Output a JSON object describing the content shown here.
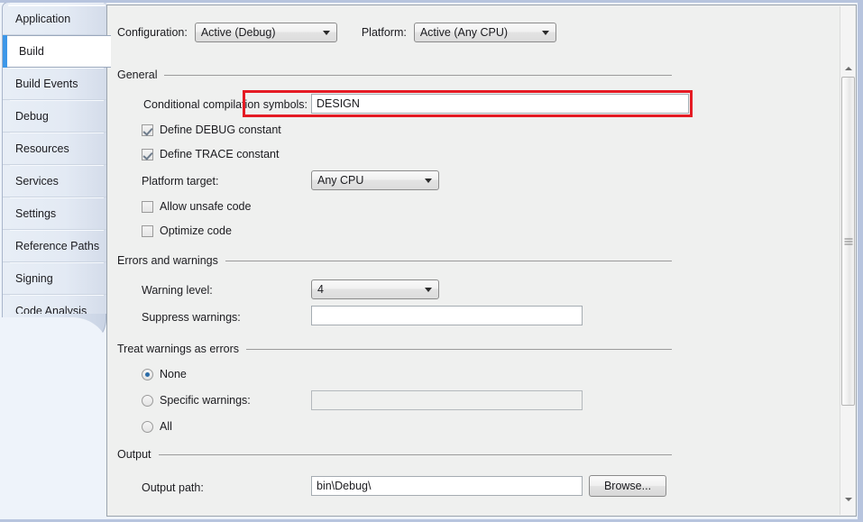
{
  "sidebar": {
    "items": [
      {
        "label": "Application",
        "selected": false
      },
      {
        "label": "Build",
        "selected": true
      },
      {
        "label": "Build Events",
        "selected": false
      },
      {
        "label": "Debug",
        "selected": false
      },
      {
        "label": "Resources",
        "selected": false
      },
      {
        "label": "Services",
        "selected": false
      },
      {
        "label": "Settings",
        "selected": false
      },
      {
        "label": "Reference Paths",
        "selected": false
      },
      {
        "label": "Signing",
        "selected": false
      },
      {
        "label": "Code Analysis",
        "selected": false
      }
    ]
  },
  "toolbar": {
    "configuration_label": "Configuration:",
    "configuration_value": "Active (Debug)",
    "platform_label": "Platform:",
    "platform_value": "Active (Any CPU)"
  },
  "general": {
    "title": "General",
    "conditional_symbols_label": "Conditional compilation symbols:",
    "conditional_symbols_value": "DESIGN",
    "define_debug_label": "Define DEBUG constant",
    "define_debug_checked": true,
    "define_trace_label": "Define TRACE constant",
    "define_trace_checked": true,
    "platform_target_label": "Platform target:",
    "platform_target_value": "Any CPU",
    "allow_unsafe_label": "Allow unsafe code",
    "allow_unsafe_checked": false,
    "optimize_code_label": "Optimize code",
    "optimize_code_checked": false
  },
  "errors_warnings": {
    "title": "Errors and warnings",
    "warning_level_label": "Warning level:",
    "warning_level_value": "4",
    "suppress_warnings_label": "Suppress warnings:",
    "suppress_warnings_value": ""
  },
  "treat_warnings": {
    "title": "Treat warnings as errors",
    "none_label": "None",
    "none_selected": true,
    "specific_label": "Specific warnings:",
    "specific_selected": false,
    "specific_value": "",
    "all_label": "All",
    "all_selected": false
  },
  "output": {
    "title": "Output",
    "output_path_label": "Output path:",
    "output_path_value": "bin\\Debug\\",
    "browse_label": "Browse..."
  },
  "scrollbar": {
    "up_icon": "triangle-up-icon",
    "down_icon": "triangle-down-icon"
  },
  "annotation": {
    "highlight_color": "#e51b24"
  },
  "theme": {
    "accent": "#3d97e8",
    "panel_bg": "#eff0ef",
    "window_bg": "#eef3fa"
  }
}
